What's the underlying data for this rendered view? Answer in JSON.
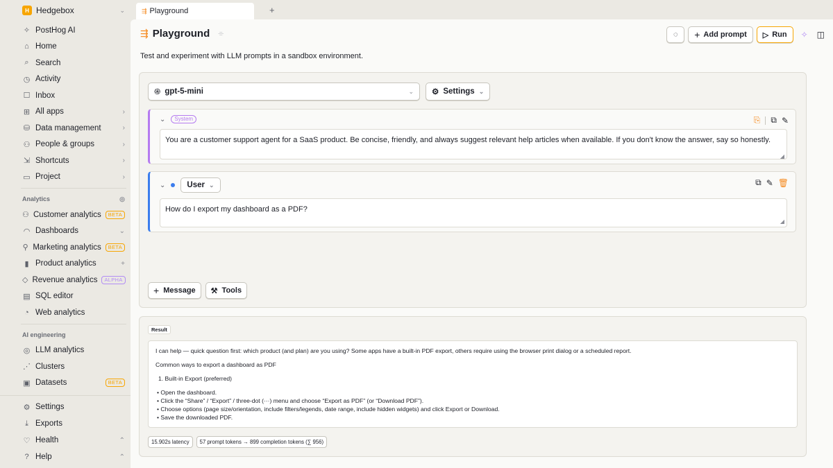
{
  "org": {
    "initial": "H",
    "name": "Hedgebox"
  },
  "sidebar": {
    "top_items": [
      {
        "icon": "✧",
        "label": "PostHog AI"
      },
      {
        "icon": "⌂",
        "label": "Home"
      },
      {
        "icon": "⌕",
        "label": "Search"
      },
      {
        "icon": "◷",
        "label": "Activity"
      },
      {
        "icon": "☐",
        "label": "Inbox"
      },
      {
        "icon": "⊞",
        "label": "All apps",
        "right": "›"
      },
      {
        "icon": "⛁",
        "label": "Data management",
        "right": "›"
      },
      {
        "icon": "⚇",
        "label": "People & groups",
        "right": "›"
      },
      {
        "icon": "⇲",
        "label": "Shortcuts",
        "right": "›"
      },
      {
        "icon": "▭",
        "label": "Project",
        "right": "›"
      }
    ],
    "analytics_heading": "Analytics",
    "analytics_items": [
      {
        "icon": "⚇",
        "label": "Customer analytics",
        "badge": "BETA"
      },
      {
        "icon": "◠",
        "label": "Dashboards",
        "right": "⌄"
      },
      {
        "icon": "⚲",
        "label": "Marketing analytics",
        "badge": "BETA"
      },
      {
        "icon": "▮",
        "label": "Product analytics",
        "right": "+"
      },
      {
        "icon": "◇",
        "label": "Revenue analytics",
        "badge": "ALPHA"
      },
      {
        "icon": "▤",
        "label": "SQL editor"
      },
      {
        "icon": "◔",
        "label": "Web analytics"
      }
    ],
    "ai_heading": "AI engineering",
    "ai_items": [
      {
        "icon": "◎",
        "label": "LLM analytics"
      },
      {
        "icon": "⋰",
        "label": "Clusters"
      },
      {
        "icon": "▣",
        "label": "Datasets",
        "badge": "BETA"
      }
    ],
    "bottom_items": [
      {
        "icon": "⚙",
        "label": "Settings"
      },
      {
        "icon": "⤓",
        "label": "Exports"
      },
      {
        "icon": "♡",
        "label": "Health",
        "right": "⌃"
      },
      {
        "icon": "?",
        "label": "Help",
        "right": "⌃"
      }
    ]
  },
  "tabs": {
    "active": "Playground",
    "new_tab": "+"
  },
  "page": {
    "title": "Playground",
    "description": "Test and experiment with LLM prompts in a sandbox environment.",
    "add_prompt_label": "Add prompt",
    "run_label": "Run"
  },
  "prompt": {
    "model": "gpt-5-mini",
    "settings_label": "Settings",
    "system": {
      "role": "System",
      "content": "You are a customer support agent for a SaaS product. Be concise, friendly, and always suggest relevant help articles when available. If you don't know the answer, say so honestly."
    },
    "user": {
      "role": "User",
      "content": "How do I export my dashboard as a PDF?"
    },
    "message_btn": "Message",
    "tools_btn": "Tools"
  },
  "result": {
    "label": "Result",
    "intro": "I can help — quick question first: which product (and plan) are you using? Some apps have a built-in PDF export, others require using the browser print dialog or a scheduled report.",
    "subheading": "Common ways to export a dashboard as PDF",
    "step": "1. Built-in Export (preferred)",
    "bullets": [
      "Open the dashboard.",
      "Click the “Share” / “Export” / three-dot (···) menu and choose “Export as PDF” (or “Download PDF”).",
      "Choose options (page size/orientation, include filters/legends, date range, include hidden widgets) and click Export or Download.",
      "Save the downloaded PDF."
    ],
    "latency": "15.902s latency",
    "tokens": "57 prompt tokens → 899 completion tokens (∑ 956)"
  },
  "colors": {
    "accent": "#f7a501",
    "system_border": "#b57bf0",
    "user_border": "#3b7ded"
  }
}
